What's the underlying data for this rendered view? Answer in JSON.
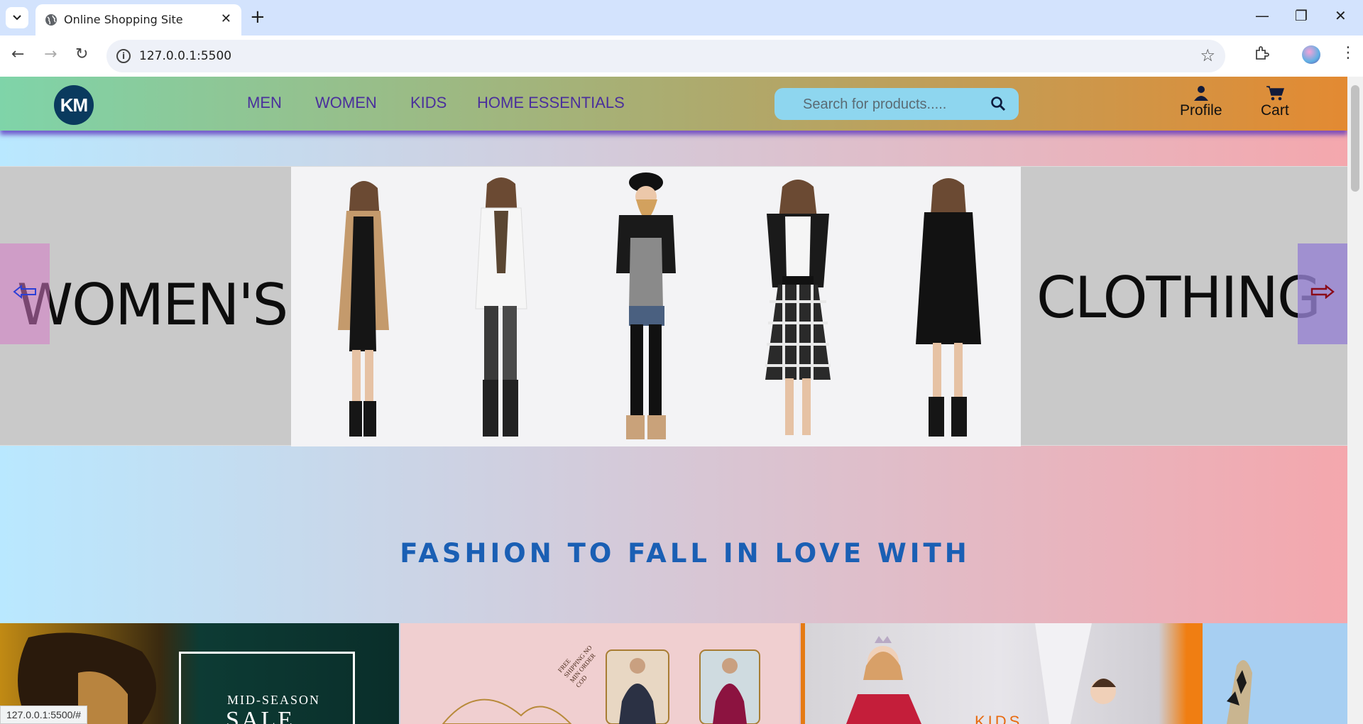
{
  "browser": {
    "tab_title": "Online Shopping Site",
    "url": "127.0.0.1:5500",
    "status_url": "127.0.0.1:5500/#"
  },
  "site": {
    "logo": "KM",
    "nav": [
      "MEN",
      "WOMEN",
      "KIDS",
      "HOME ESSENTIALS"
    ],
    "search_placeholder": "Search for products.....",
    "profile_label": "Profile",
    "cart_label": "Cart",
    "hero": {
      "left_word": "WOMEN'S",
      "right_word": "CLOTHING"
    },
    "tagline": "FASHION TO FALL IN LOVE WITH",
    "tiles": [
      {
        "line1": "MID-SEASON",
        "line2": "SALE"
      },
      {
        "circle_text": "FREE SHIPPING NO MIN ORDER COD"
      },
      {
        "text": "KIDS"
      },
      {
        "text": ""
      }
    ]
  },
  "colors": {
    "nav_text": "#4a2f9c",
    "tagline": "#1a5fb4",
    "search_bg": "#8ed6ef"
  },
  "icons": [
    "globe-icon",
    "search-icon",
    "user-icon",
    "cart-icon",
    "star-icon",
    "extension-icon",
    "left-arrow-icon",
    "right-arrow-icon"
  ]
}
